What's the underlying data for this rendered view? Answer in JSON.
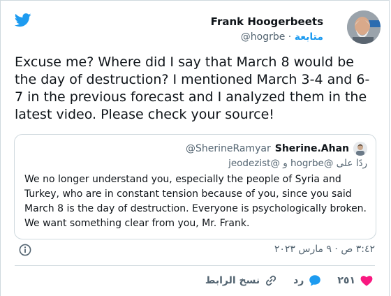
{
  "author": {
    "name": "Frank Hoogerbeets",
    "handle": "@hogrbe",
    "separator": "·",
    "follow_label": "متابعة"
  },
  "tweet": {
    "text": "Excuse me? Where did I say that March 8 would be the day of destruction? I mentioned March 3-4 and 6-7 in the previous forecast and I analyzed them in the latest video. Please check your source!"
  },
  "quoted_tweet": {
    "name": "Sherine.Ahan",
    "handle": "@SherineRamyar",
    "reply_to": "ردًا على @hogrbe و @jeodezist",
    "text": "We no longer understand you, especially the people of Syria and Turkey, who are in constant tension because of you, since you said March 8 is the day of destruction. Everyone is psychologically broken. We want something clear from you, Mr. Frank."
  },
  "timestamp": "٣:٤٢ ص · ٩ مارس ٢٠٢٣",
  "actions": {
    "like_count": "٢٥١",
    "reply_label": "رد",
    "copy_link_label": "نسخ الرابط"
  },
  "colors": {
    "brand": "#1d9bf0",
    "like": "#f91880",
    "secondary_text": "#536471",
    "border": "#cfd9de"
  },
  "icons": [
    "twitter-bird-icon",
    "info-icon",
    "heart-icon",
    "reply-bubble-icon",
    "link-icon"
  ]
}
